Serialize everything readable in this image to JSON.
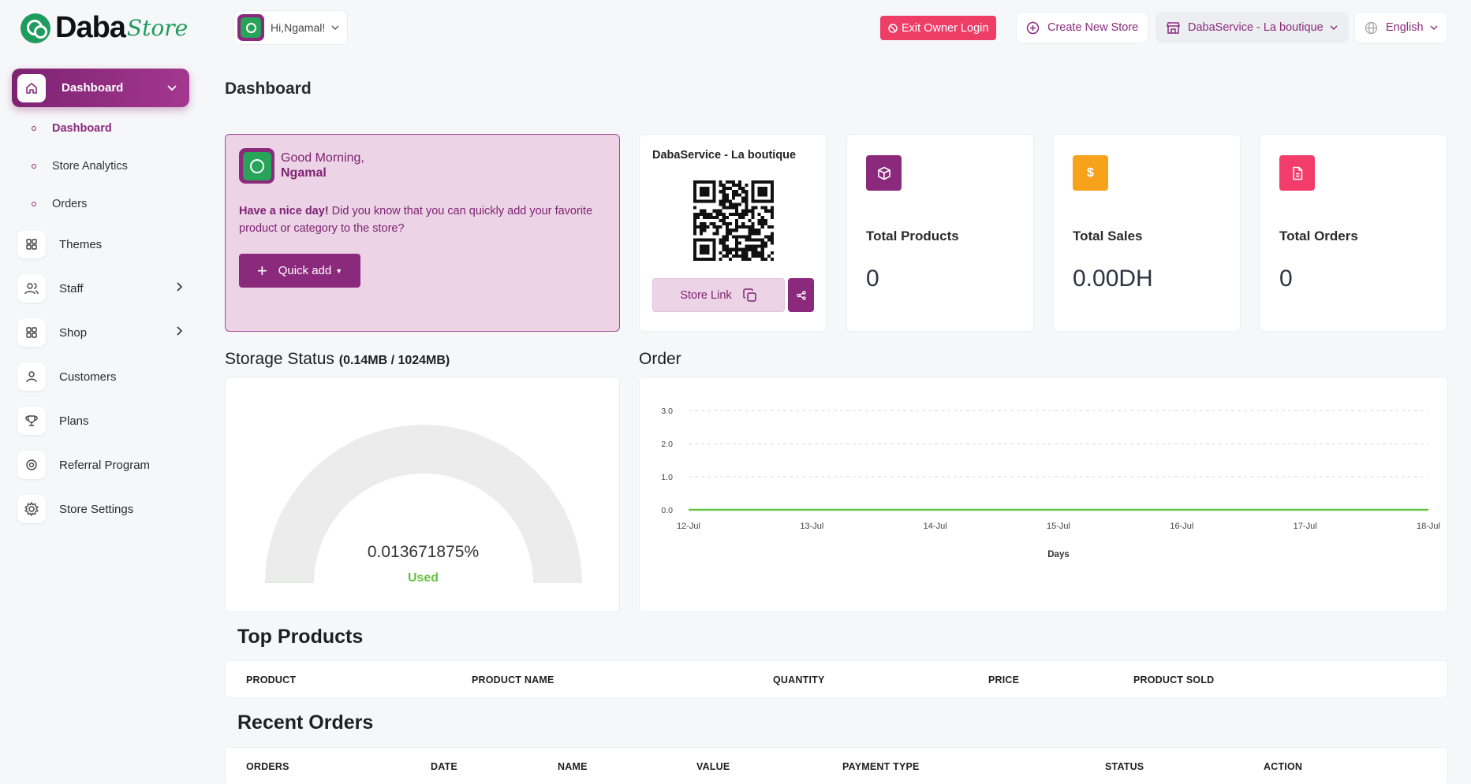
{
  "brand": {
    "name": "Daba",
    "accent": "Store"
  },
  "sidebar": {
    "active": {
      "label": "Dashboard"
    },
    "subitems": [
      {
        "label": "Dashboard"
      },
      {
        "label": "Store Analytics"
      },
      {
        "label": "Orders"
      }
    ],
    "items": [
      {
        "label": "Themes",
        "icon": "grid-icon"
      },
      {
        "label": "Staff",
        "icon": "users-icon"
      },
      {
        "label": "Shop",
        "icon": "grid-icon"
      },
      {
        "label": "Customers",
        "icon": "user-icon"
      },
      {
        "label": "Plans",
        "icon": "trophy-icon"
      },
      {
        "label": "Referral Program",
        "icon": "target-icon"
      },
      {
        "label": "Store Settings",
        "icon": "gear-icon"
      }
    ]
  },
  "header": {
    "greeting": "Hi,Ngamal!",
    "exit_label": "Exit Owner Login",
    "create_label": "Create New Store",
    "store_label": "DabaService - La boutique",
    "language": "English"
  },
  "page": {
    "title": "Dashboard"
  },
  "welcome": {
    "greeting": "Good Morning,",
    "name": "Ngamal",
    "bold": "Have a nice day!",
    "text": " Did you know that you can quickly add your favorite product or category to the store?",
    "button": "Quick add"
  },
  "store_card": {
    "title": "DabaService - La boutique",
    "link_label": "Store Link"
  },
  "stats": [
    {
      "label": "Total Products",
      "value": "0",
      "color": "#8b2a7c"
    },
    {
      "label": "Total Sales",
      "value": "0.00DH",
      "color": "#f6a21a"
    },
    {
      "label": "Total Orders",
      "value": "0",
      "color": "#f23d6b"
    }
  ],
  "storage": {
    "title": "Storage Status",
    "usage": "(0.14MB / 1024MB)",
    "percent_text": "0.013671875%",
    "used_label": "Used",
    "percent_value": 0.013671875
  },
  "order_section": {
    "title": "Order"
  },
  "chart_data": {
    "type": "line",
    "title": "",
    "xlabel": "Days",
    "ylabel": "",
    "categories": [
      "12-Jul",
      "13-Jul",
      "14-Jul",
      "15-Jul",
      "16-Jul",
      "17-Jul",
      "18-Jul"
    ],
    "series": [
      {
        "values": [
          0,
          0,
          0,
          0,
          0,
          0,
          0
        ]
      }
    ],
    "ylim": [
      0,
      3
    ],
    "yticks": [
      "0.0",
      "1.0",
      "2.0",
      "3.0"
    ],
    "grid": true,
    "line_color": "#67c146"
  },
  "top_products": {
    "title": "Top Products",
    "columns": [
      "PRODUCT",
      "PRODUCT NAME",
      "QUANTITY",
      "PRICE",
      "PRODUCT SOLD"
    ]
  },
  "recent_orders": {
    "title": "Recent Orders",
    "columns": [
      "ORDERS",
      "DATE",
      "NAME",
      "VALUE",
      "PAYMENT TYPE",
      "STATUS",
      "ACTION"
    ]
  }
}
